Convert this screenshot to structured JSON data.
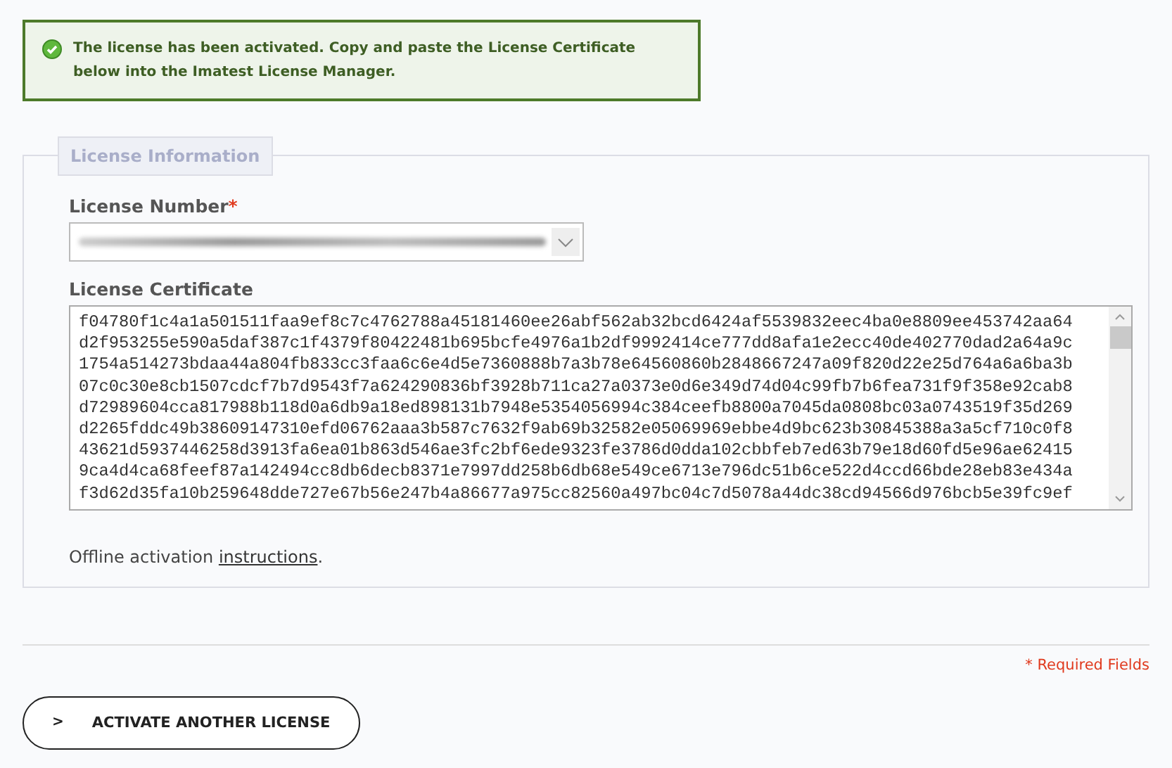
{
  "notice": {
    "text": "The license has been activated. Copy and paste the License Certificate below into the Imatest License Manager."
  },
  "fieldset": {
    "legend": "License Information",
    "license_number": {
      "label": "License Number",
      "required_mark": "*"
    },
    "certificate": {
      "label": "License Certificate",
      "lines": [
        "f04780f1c4a1a501511faa9ef8c7c4762788a45181460ee26abf562ab32bcd6424af5539832eec4ba0e8809ee453742aa64",
        "d2f953255e590a5daf387c1f4379f80422481b695bcfe4976a1b2df9992414ce777dd8afa1e2ecc40de402770dad2a64a9c",
        "1754a514273bdaa44a804fb833cc3faa6c6e4d5e7360888b7a3b78e64560860b2848667247a09f820d22e25d764a6a6ba3b",
        "07c0c30e8cb1507cdcf7b7d9543f7a624290836bf3928b711ca27a0373e0d6e349d74d04c99fb7b6fea731f9f358e92cab8",
        "d72989604cca817988b118d0a6db9a18ed898131b7948e5354056994c384ceefb8800a7045da0808bc03a0743519f35d269",
        "d2265fddc49b38609147310efd06762aaa3b587c7632f9ab69b32582e05069969ebbe4d9bc623b30845388a3a5cf710c0f8",
        "43621d5937446258d3913fa6ea01b863d546ae3fc2bf6ede9323fe3786d0dda102cbbfeb7ed63b79e18d60fd5e96ae62415",
        "9ca4d4ca68feef87a142494cc8db6decb8371e7997dd258b6db68e549ce6713e796dc51b6ce522d4ccd66bde28eb83e434a",
        "f3d62d35fa10b259648dde727e67b56e247b4a86677a975cc82560a497bc04c7d5078a44dc38cd94566d976bcb5e39fc9ef"
      ]
    },
    "offline": {
      "text": "Offline activation ",
      "link": "instructions",
      "end": "."
    }
  },
  "required_note": {
    "mark": "*",
    "text": " Required Fields"
  },
  "button": {
    "icon": ">",
    "label": "ACTIVATE ANOTHER LICENSE"
  }
}
